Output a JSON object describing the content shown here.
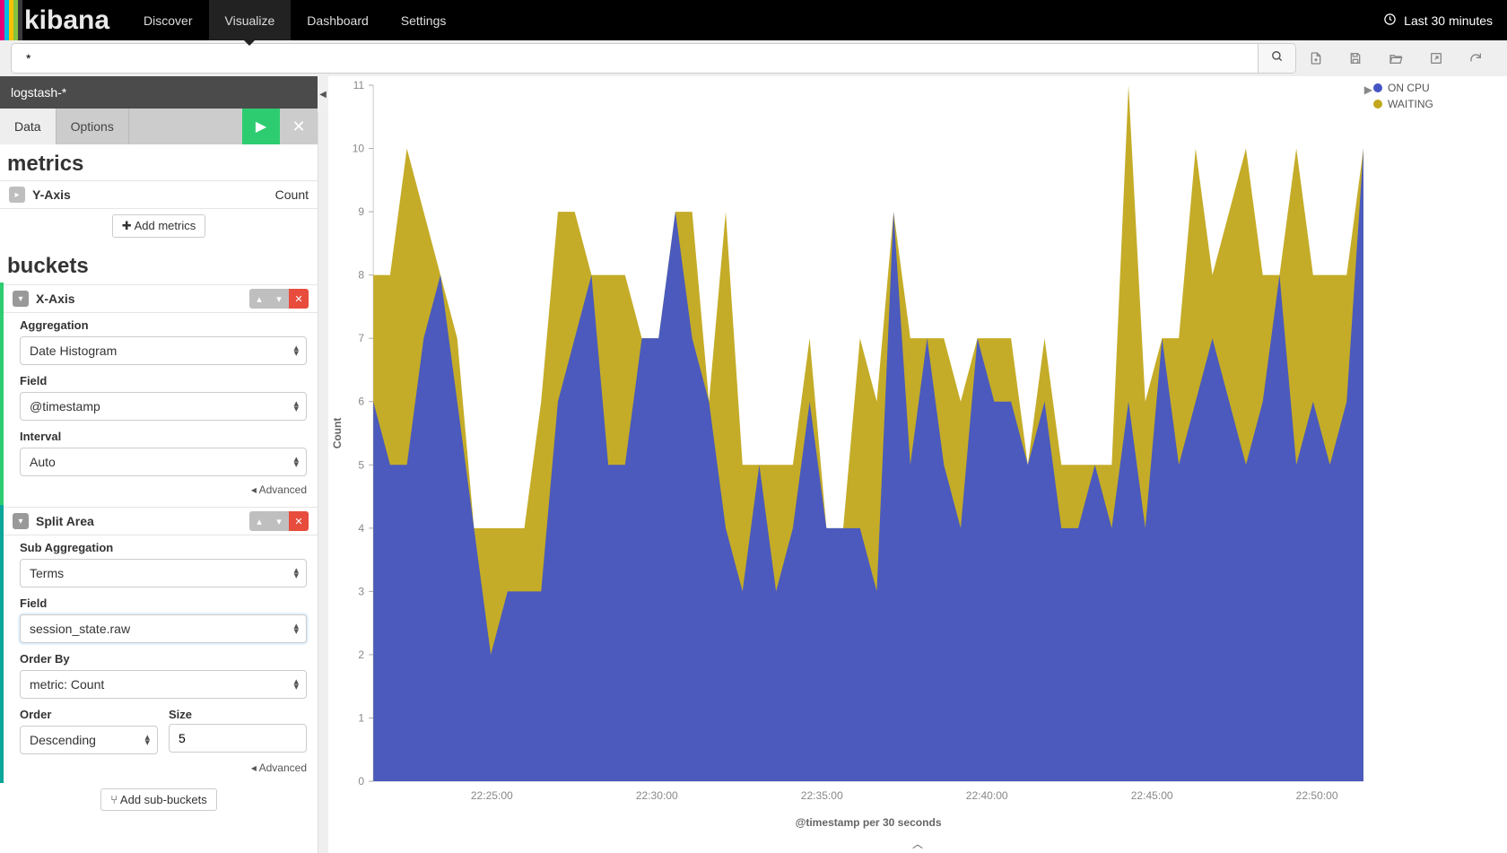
{
  "brand": {
    "name": "kibana",
    "stripe_colors": [
      "#e2017b",
      "#00b9e4",
      "#f4c104",
      "#84c340",
      "#3b3b3b"
    ]
  },
  "nav": {
    "items": [
      "Discover",
      "Visualize",
      "Dashboard",
      "Settings"
    ],
    "active": "Visualize",
    "time_label": "Last 30 minutes"
  },
  "search": {
    "query": "*"
  },
  "toolbar_icons": [
    "new",
    "save",
    "open",
    "share",
    "refresh"
  ],
  "index_pattern": "logstash-*",
  "panel": {
    "tabs": [
      "Data",
      "Options"
    ],
    "active": "Data"
  },
  "metrics": {
    "title": "metrics",
    "yaxis_label": "Y-Axis",
    "yaxis_agg": "Count",
    "add_label": "Add metrics"
  },
  "buckets": {
    "title": "buckets",
    "xaxis": {
      "label": "X-Axis",
      "agg_label": "Aggregation",
      "agg_value": "Date Histogram",
      "field_label": "Field",
      "field_value": "@timestamp",
      "interval_label": "Interval",
      "interval_value": "Auto",
      "advanced_label": "Advanced"
    },
    "split": {
      "label": "Split Area",
      "subagg_label": "Sub Aggregation",
      "subagg_value": "Terms",
      "field_label": "Field",
      "field_value": "session_state.raw",
      "orderby_label": "Order By",
      "orderby_value": "metric: Count",
      "order_label": "Order",
      "order_value": "Descending",
      "size_label": "Size",
      "size_value": "5",
      "advanced_label": "Advanced",
      "add_sub": "Add sub-buckets"
    }
  },
  "legend": [
    {
      "name": "ON CPU",
      "color": "#4555c4"
    },
    {
      "name": "WAITING",
      "color": "#c1a81c"
    }
  ],
  "chart_data": {
    "type": "area",
    "title": "",
    "ylabel": "Count",
    "xlabel": "@timestamp per 30 seconds",
    "ylim": [
      0,
      11
    ],
    "y_ticks": [
      0,
      1,
      2,
      3,
      4,
      5,
      6,
      7,
      8,
      9,
      10,
      11
    ],
    "x_ticks": [
      "22:25:00",
      "22:30:00",
      "22:35:00",
      "22:40:00",
      "22:45:00",
      "22:50:00"
    ],
    "stacked": true,
    "categories_count": 60,
    "series": [
      {
        "name": "ON CPU",
        "color": "#4555c4",
        "values": [
          6,
          5,
          5,
          7,
          8,
          6,
          4,
          2,
          3,
          3,
          3,
          6,
          7,
          8,
          5,
          5,
          7,
          7,
          9,
          7,
          6,
          4,
          3,
          5,
          3,
          4,
          6,
          4,
          4,
          4,
          3,
          9,
          5,
          7,
          5,
          4,
          7,
          6,
          6,
          5,
          6,
          4,
          4,
          5,
          4,
          6,
          4,
          7,
          5,
          6,
          7,
          6,
          5,
          6,
          8,
          5,
          6,
          5,
          6,
          10
        ]
      },
      {
        "name": "WAITING",
        "color": "#c1a81c",
        "values": [
          2,
          3,
          5,
          2,
          0,
          1,
          0,
          2,
          1,
          1,
          3,
          3,
          2,
          0,
          3,
          3,
          0,
          0,
          0,
          2,
          0,
          5,
          2,
          0,
          2,
          1,
          1,
          0,
          0,
          3,
          3,
          0,
          2,
          0,
          2,
          2,
          0,
          1,
          1,
          0,
          1,
          1,
          1,
          0,
          1,
          5,
          2,
          0,
          2,
          4,
          1,
          3,
          5,
          2,
          0,
          5,
          2,
          3,
          2,
          0
        ]
      }
    ]
  }
}
